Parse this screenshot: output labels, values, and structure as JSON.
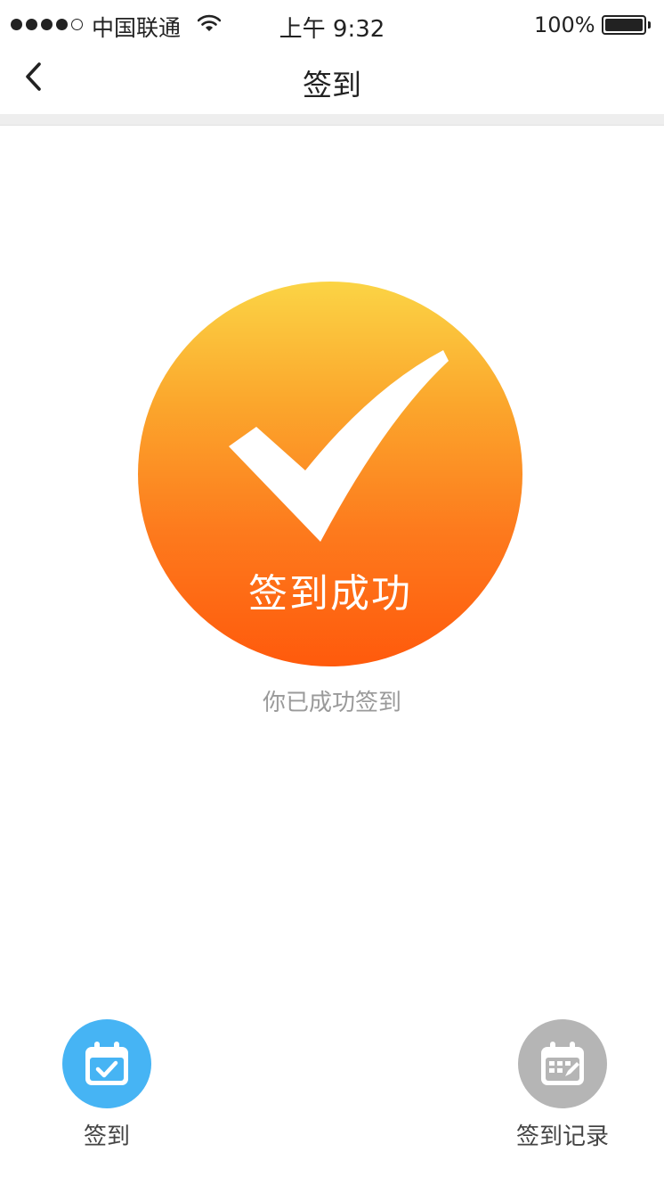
{
  "status_bar": {
    "carrier": "中国联通",
    "time": "上午 9:32",
    "battery": "100%"
  },
  "nav": {
    "title": "签到",
    "back_icon": "chevron-left-icon"
  },
  "result": {
    "badge_text": "签到成功",
    "subtitle": "你已成功签到",
    "icon": "checkmark-icon"
  },
  "actions": [
    {
      "label": "签到",
      "icon": "calendar-check-icon",
      "color": "#46b4f4",
      "active": true
    },
    {
      "label": "签到记录",
      "icon": "calendar-grid-edit-icon",
      "color": "#b5b5b5",
      "active": false
    }
  ],
  "colors": {
    "accent_blue": "#46b4f4",
    "gradient_top": "#fbd445",
    "gradient_bottom": "#ff5a0c",
    "inactive_gray": "#b5b5b5"
  }
}
